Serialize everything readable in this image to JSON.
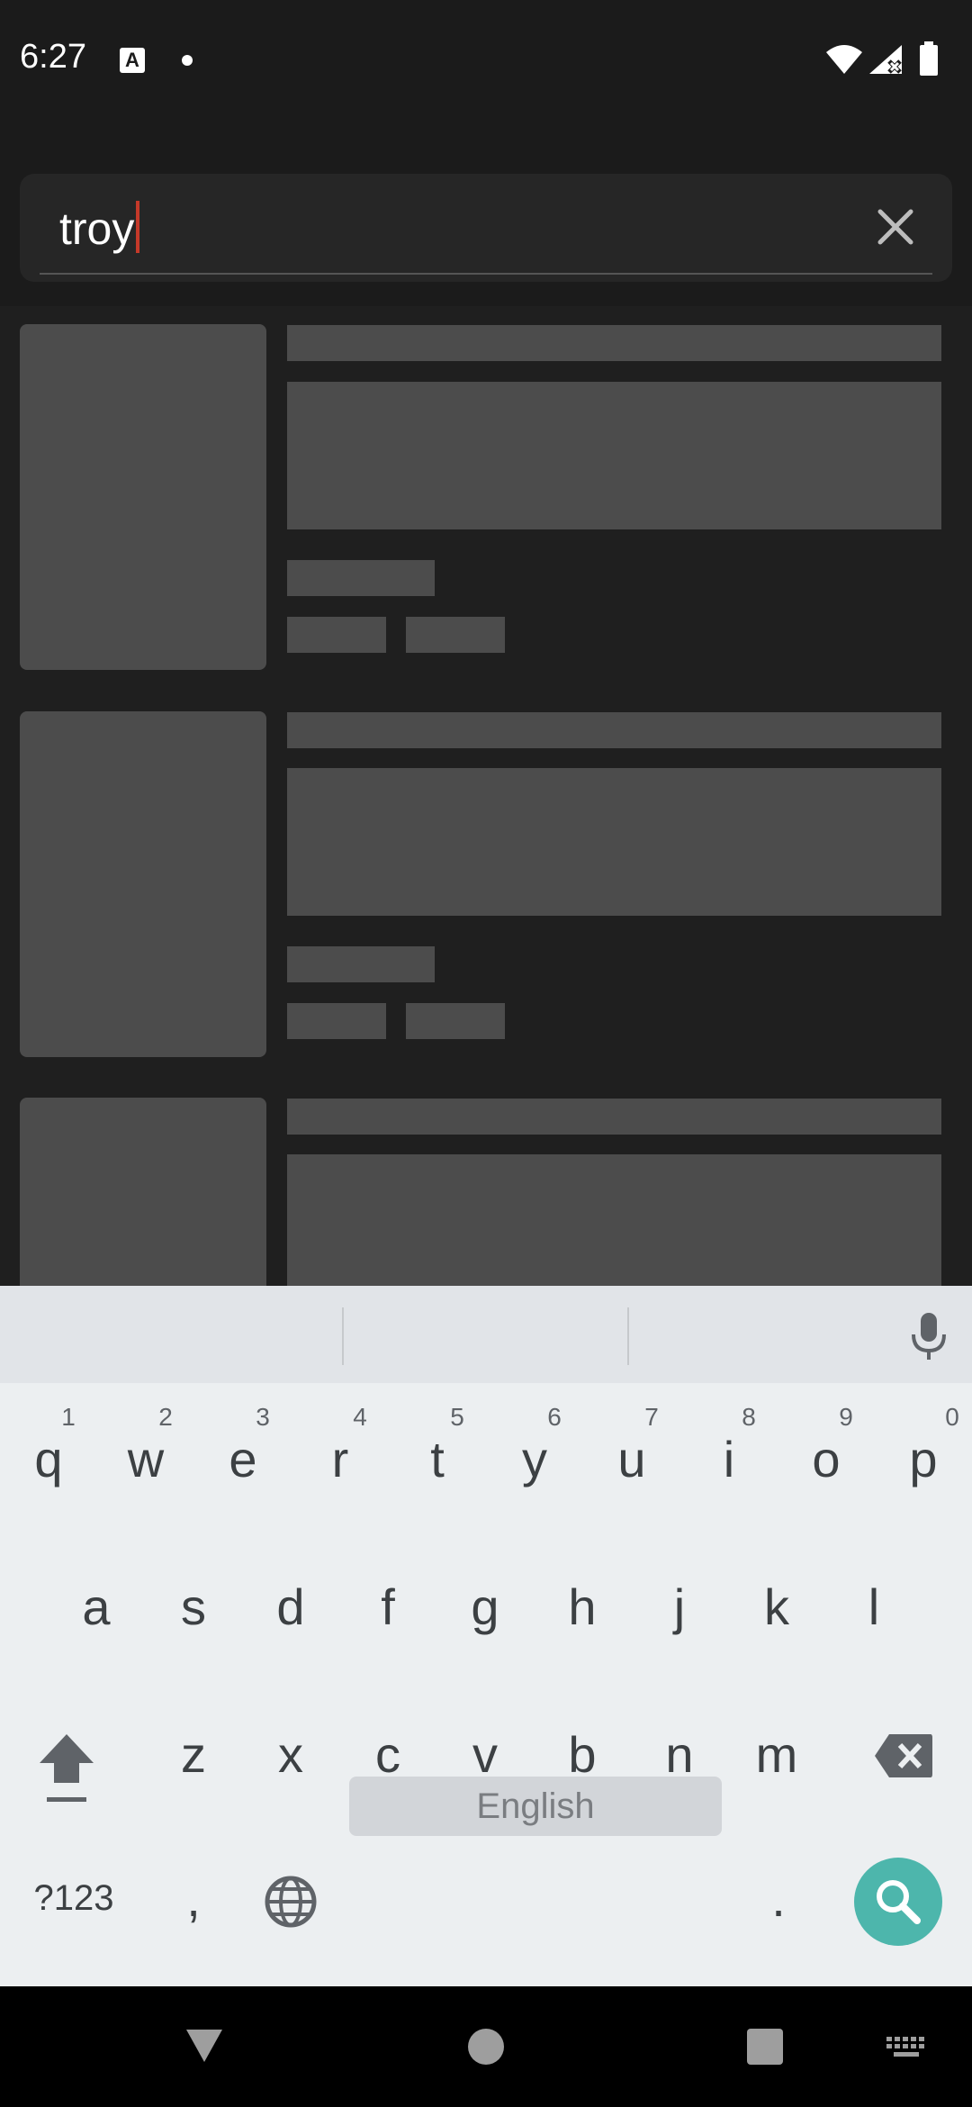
{
  "status_bar": {
    "time": "6:27",
    "notification_icon": "A"
  },
  "search": {
    "query": "troy"
  },
  "keyboard": {
    "row1": [
      {
        "k": "q",
        "h": "1"
      },
      {
        "k": "w",
        "h": "2"
      },
      {
        "k": "e",
        "h": "3"
      },
      {
        "k": "r",
        "h": "4"
      },
      {
        "k": "t",
        "h": "5"
      },
      {
        "k": "y",
        "h": "6"
      },
      {
        "k": "u",
        "h": "7"
      },
      {
        "k": "i",
        "h": "8"
      },
      {
        "k": "o",
        "h": "9"
      },
      {
        "k": "p",
        "h": "0"
      }
    ],
    "row2": [
      "a",
      "s",
      "d",
      "f",
      "g",
      "h",
      "j",
      "k",
      "l"
    ],
    "row3": [
      "z",
      "x",
      "c",
      "v",
      "b",
      "n",
      "m"
    ],
    "symbols_label": "?123",
    "comma": ",",
    "space_label": "English",
    "period": "."
  }
}
